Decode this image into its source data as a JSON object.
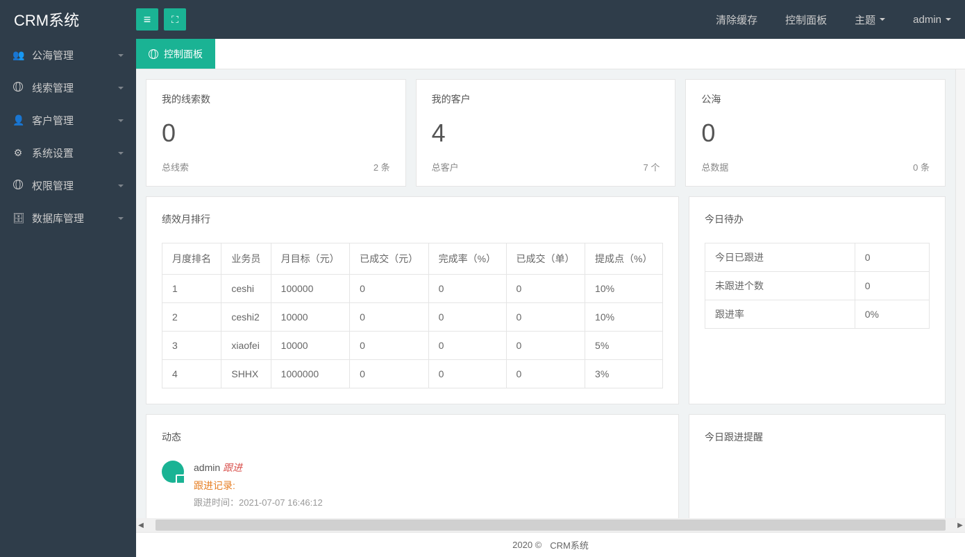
{
  "brand": "CRM系统",
  "header": {
    "links": {
      "clear_cache": "清除缓存",
      "control_panel": "控制面板",
      "theme": "主题",
      "user": "admin"
    }
  },
  "sidebar": {
    "items": [
      {
        "label": "公海管理"
      },
      {
        "label": "线索管理"
      },
      {
        "label": "客户管理"
      },
      {
        "label": "系统设置"
      },
      {
        "label": "权限管理"
      },
      {
        "label": "数据库管理"
      }
    ]
  },
  "tab": {
    "label": "控制面板"
  },
  "cards": [
    {
      "title": "我的线索数",
      "num": "0",
      "sub_l": "总线索",
      "sub_r": "2 条"
    },
    {
      "title": "我的客户",
      "num": "4",
      "sub_l": "总客户",
      "sub_r": "7 个"
    },
    {
      "title": "公海",
      "num": "0",
      "sub_l": "总数据",
      "sub_r": "0 条"
    }
  ],
  "ranking": {
    "title": "绩效月排行",
    "headers": [
      "月度排名",
      "业务员",
      "月目标（元）",
      "已成交（元）",
      "完成率（%）",
      "已成交（单）",
      "提成点（%）"
    ],
    "rows": [
      [
        "1",
        "ceshi",
        "100000",
        "0",
        "0",
        "0",
        "10%"
      ],
      [
        "2",
        "ceshi2",
        "10000",
        "0",
        "0",
        "0",
        "10%"
      ],
      [
        "3",
        "xiaofei",
        "10000",
        "0",
        "0",
        "0",
        "5%"
      ],
      [
        "4",
        "SHHX",
        "1000000",
        "0",
        "0",
        "0",
        "3%"
      ]
    ]
  },
  "todo": {
    "title": "今日待办",
    "rows": [
      {
        "label": "今日已跟进",
        "val": "0"
      },
      {
        "label": "未跟进个数",
        "val": "0"
      },
      {
        "label": "跟进率",
        "val": "0%"
      }
    ]
  },
  "activity": {
    "title": "动态",
    "user": "admin",
    "action": "跟进",
    "record_label": "跟进记录:",
    "time_label": "跟进时间：",
    "time_val": "2021-07-07 16:46:12"
  },
  "remind": {
    "title": "今日跟进提醒"
  },
  "footer": {
    "copy": "2020 ©",
    "name": "CRM系统"
  }
}
